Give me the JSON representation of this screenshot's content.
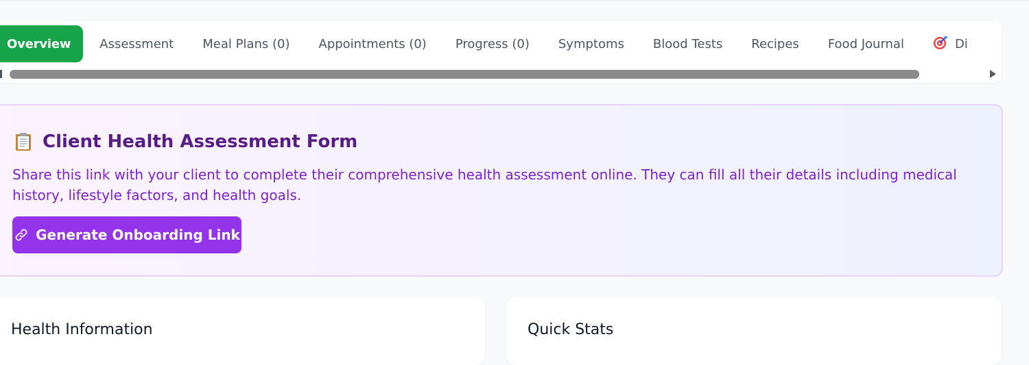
{
  "tabs": [
    {
      "label": "Overview",
      "active": true
    },
    {
      "label": "Assessment"
    },
    {
      "label": "Meal Plans (0)"
    },
    {
      "label": "Appointments (0)"
    },
    {
      "label": "Progress (0)"
    },
    {
      "label": "Symptoms"
    },
    {
      "label": "Blood Tests"
    },
    {
      "label": "Recipes"
    },
    {
      "label": "Food Journal"
    },
    {
      "label": "Di",
      "icon": "target-icon"
    }
  ],
  "assessment": {
    "icon": "clipboard-icon",
    "title": "Client Health Assessment Form",
    "description": "Share this link with your client to complete their comprehensive health assessment online. They can fill all their details including medical history, lifestyle factors, and health goals.",
    "button_label": "Generate Onboarding Link",
    "button_icon": "link-icon"
  },
  "cards": {
    "health_title": "Health Information",
    "stats_title": "Quick Stats"
  },
  "colors": {
    "active_tab": "#16a34a",
    "accent_purple": "#9333ea",
    "title_purple": "#581c87",
    "desc_purple": "#7e22ce"
  }
}
